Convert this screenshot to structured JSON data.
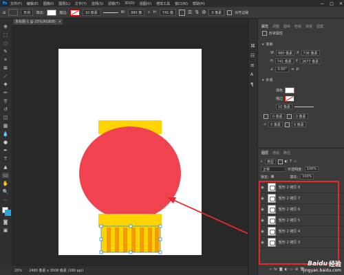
{
  "menubar": {
    "logo": "Ps",
    "items": [
      "文件(F)",
      "编辑(E)",
      "图像(I)",
      "图层(L)",
      "文字(Y)",
      "选择(S)",
      "滤镜(T)",
      "3D(D)",
      "视图(V)",
      "增效工具",
      "窗口(W)",
      "帮助(H)"
    ],
    "controls": [
      "—",
      "□",
      "✕"
    ]
  },
  "options_bar": {
    "shape_mode": "形状",
    "fill_label": "填充:",
    "stroke_label": "描边:",
    "stroke_width": "10 像素",
    "w_label": "W:",
    "w_value": "980 像",
    "h_label": "H:",
    "h_value": "741 像",
    "align_edges": "对齐边缘",
    "corner": "0 像素"
  },
  "document_tab": {
    "title": "未标题-1 @ 25%(RGB/8)",
    "close": "×"
  },
  "status": {
    "zoom": "25%",
    "doc_size": "2480 像素 x 3508 像素 (300 ppi)"
  },
  "properties": {
    "tabs": [
      "属性",
      "调整",
      "图库",
      "色板",
      "渐变",
      "图案"
    ],
    "subtitle": "形状属性",
    "transform_title": "变换",
    "w": "980 像素",
    "h": "741 像素",
    "x": "736 像素",
    "y": "2677 像素",
    "angle": "0.00°",
    "appearance_title": "外观",
    "fill_label": "填色",
    "stroke_label": "描边",
    "stroke_width": "10 像素",
    "corner_values": [
      "0 像素",
      "0 像素",
      "0 像素",
      "0 像素"
    ]
  },
  "layers": {
    "tabs": [
      "图层",
      "通道",
      "路径"
    ],
    "filter": "类型",
    "blend_mode": "正常",
    "opacity_label": "不透明度:",
    "opacity": "100%",
    "lock_label": "锁定:",
    "fill_label": "填充:",
    "fill": "100%",
    "items": [
      "矩形 2 拷贝 8",
      "矩形 2 拷贝 7",
      "矩形 2 拷贝 6",
      "矩形 2 拷贝 5",
      "矩形 2 拷贝 4",
      "矩形 2 拷贝 3"
    ]
  },
  "watermark": {
    "brand": "Baidu",
    "label": "经验",
    "url": "jingyan.baidu.com"
  },
  "colors": {
    "lantern_red": "#f0434f",
    "lantern_yellow": "#ffd400",
    "stripe_orange": "#f29a00",
    "highlight": "#e8282e"
  }
}
